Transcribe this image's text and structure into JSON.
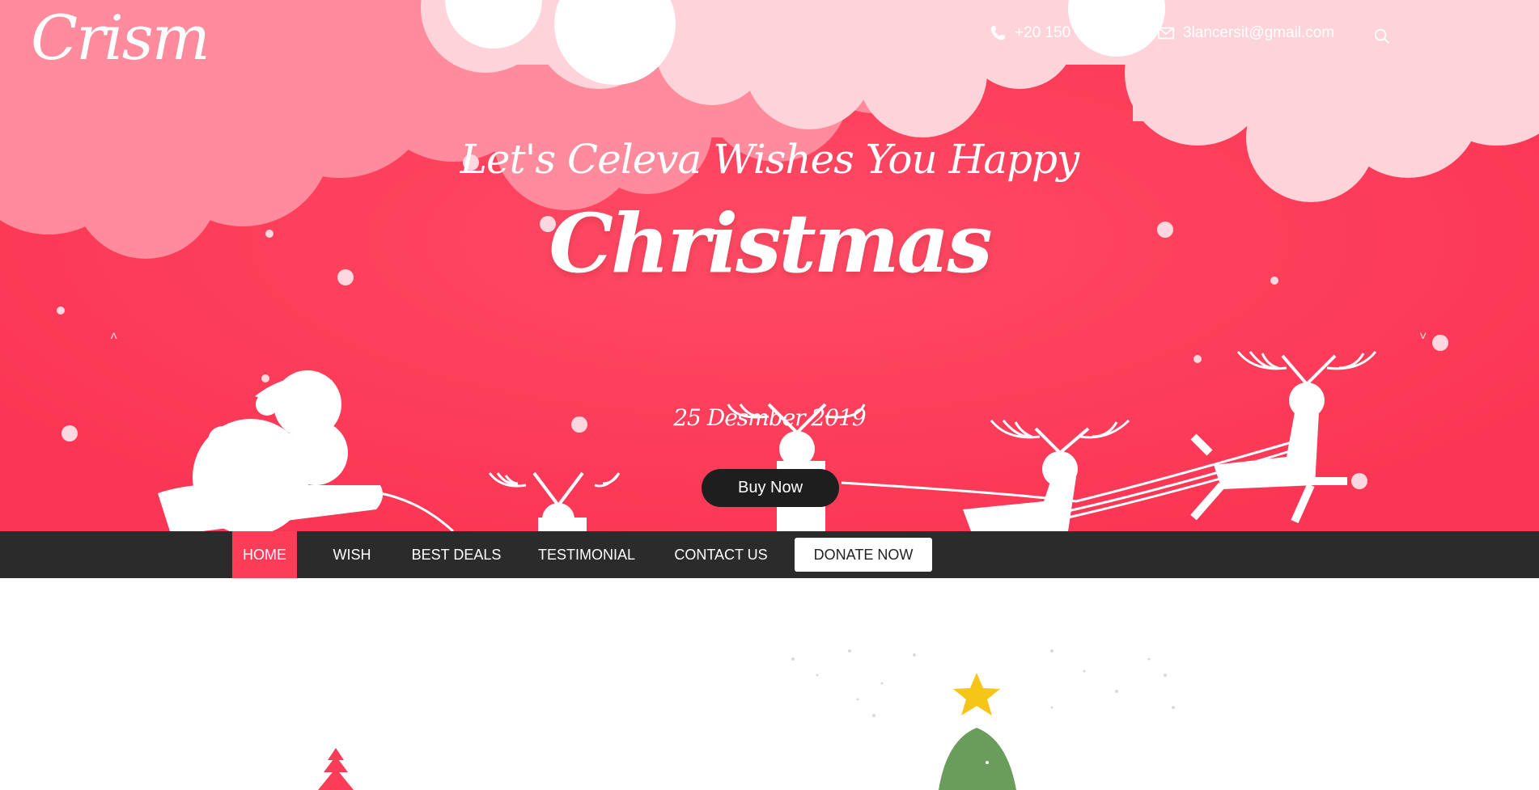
{
  "brand": {
    "logo": "Crism"
  },
  "contact": {
    "phone": "+20 150 793 4461",
    "email": "3lancersit@gmail.com"
  },
  "icons": {
    "phone": "phone-icon",
    "email": "envelope-icon",
    "search": "search-icon",
    "prev": "chevron-up-icon",
    "next": "chevron-down-icon"
  },
  "hero": {
    "tagline": "Let's Celeva Wishes You Happy",
    "headline": "Christmas",
    "date": "25 Desmber 2019",
    "cta": "Buy Now"
  },
  "nav": {
    "items": [
      {
        "label": "HOME",
        "active": true
      },
      {
        "label": "WISH",
        "active": false
      },
      {
        "label": "BEST DEALS",
        "active": false
      },
      {
        "label": "TESTIMONIAL",
        "active": false
      },
      {
        "label": "CONTACT US",
        "active": false
      }
    ],
    "donate": "DONATE NOW"
  },
  "colors": {
    "primary": "#fd3c58",
    "navbar": "#2b2b2b",
    "button": "#1e1e1e",
    "cloud_light": "#ffd3da",
    "cloud_mid": "#ff8b9c"
  }
}
